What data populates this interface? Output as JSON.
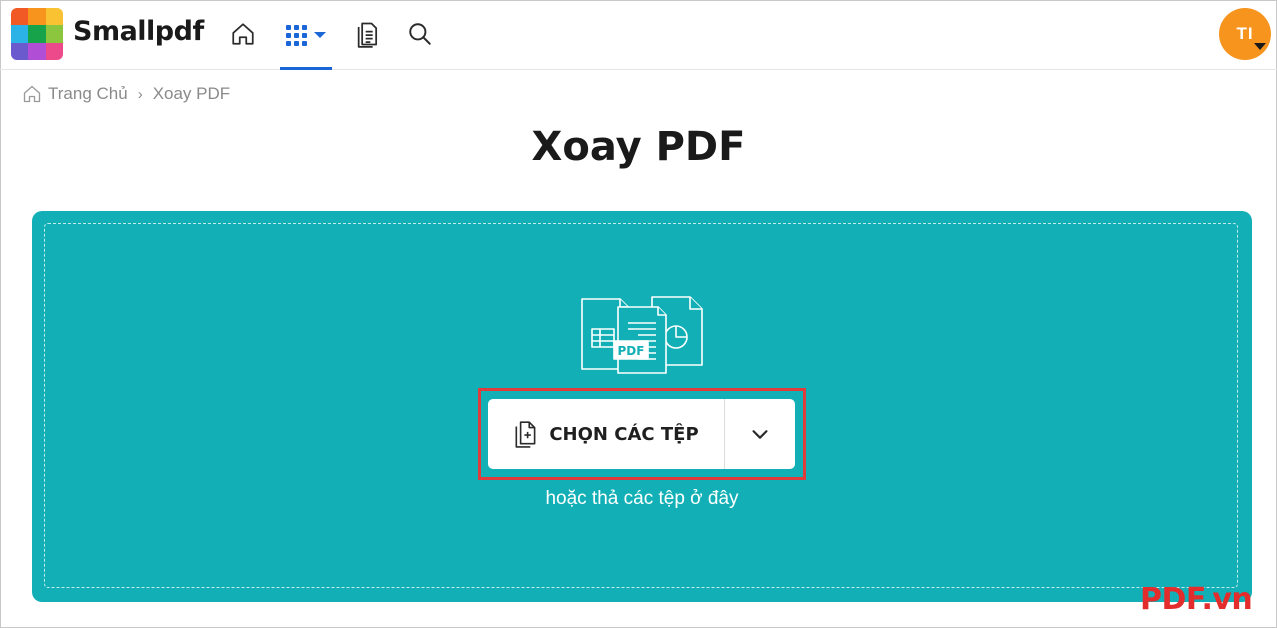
{
  "header": {
    "brand": "Smallpdf",
    "logo_colors": [
      "#f15a24",
      "#f7941d",
      "#f9c232",
      "#2bb3e8",
      "#16a34a",
      "#8cc63f",
      "#6a5acd",
      "#b04fd6",
      "#ec4a8a"
    ],
    "nav": [
      {
        "name": "home",
        "icon": "home-icon"
      },
      {
        "name": "apps",
        "icon": "grid-icon",
        "active": true
      },
      {
        "name": "documents",
        "icon": "document-icon"
      },
      {
        "name": "search",
        "icon": "search-icon"
      }
    ],
    "avatar_initials": "TI",
    "avatar_color": "#f7941d",
    "accent_color": "#1b66d6"
  },
  "breadcrumb": {
    "home_label": "Trang Chủ",
    "separator": "›",
    "current": "Xoay PDF"
  },
  "page_title": "Xoay PDF",
  "dropzone": {
    "color": "#12b0b6",
    "illustration_label": "PDF",
    "choose_button_label": "CHỌN CÁC TỆP",
    "drop_hint": "hoặc thả các tệp ở đây",
    "highlight_color": "#e03c3c"
  },
  "watermark": {
    "text": "PDF.vn"
  }
}
